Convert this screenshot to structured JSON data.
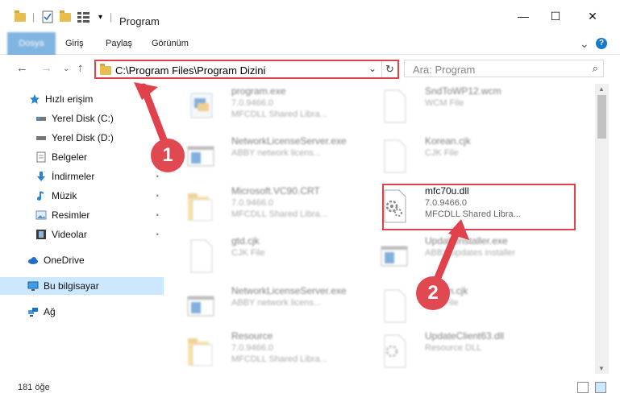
{
  "window": {
    "title": "Program",
    "minimize_glyph": "—",
    "maximize_glyph": "☐",
    "close_glyph": "✕"
  },
  "ribbon": {
    "tabs": [
      "Dosya",
      "Giriş",
      "Paylaş",
      "Görünüm"
    ],
    "expand_glyph": "⌄",
    "help_glyph": "?"
  },
  "nav": {
    "back": "←",
    "forward": "→",
    "dropdown": "⌄",
    "up": "↑"
  },
  "address": {
    "path": "C:\\Program Files\\Program Dizini",
    "dropdown": "⌄",
    "refresh": "↻"
  },
  "search": {
    "placeholder": "Ara: Program",
    "icon": "⌕"
  },
  "sidebar": {
    "items": [
      {
        "label": "Hızlı erişim",
        "icon": "star-icon"
      },
      {
        "label": "Yerel Disk (C:)",
        "icon": "drive-icon"
      },
      {
        "label": "Yerel Disk (D:)",
        "icon": "drive-icon"
      },
      {
        "label": "Belgeler",
        "icon": "document-icon"
      },
      {
        "label": "İndirmeler",
        "icon": "download-icon"
      },
      {
        "label": "Müzik",
        "icon": "music-icon"
      },
      {
        "label": "Resimler",
        "icon": "pictures-icon"
      },
      {
        "label": "Videolar",
        "icon": "video-icon"
      },
      {
        "label": "OneDrive",
        "icon": "cloud-icon"
      },
      {
        "label": "Bu bilgisayar",
        "icon": "computer-icon"
      },
      {
        "label": "Ağ",
        "icon": "network-icon"
      }
    ],
    "pin_glyph": "📌"
  },
  "files": [
    {
      "name": "program.exe",
      "line1": "7.0.9466.0",
      "line2": "MFCDLL Shared Libra...",
      "icon": "exe-icon"
    },
    {
      "name": "SndToWP12.wcm",
      "line1": "WCM File",
      "line2": "",
      "icon": "blank-file-icon"
    },
    {
      "name": "NetworkLicenseServer.exe",
      "line1": "ABBY network licens...",
      "line2": "",
      "icon": "window-app-icon"
    },
    {
      "name": "Korean.cjk",
      "line1": "CJK File",
      "line2": "",
      "icon": "blank-file-icon"
    },
    {
      "name": "Microsoft.VC90.CRT",
      "line1": "7.0.9466.0",
      "line2": "MFCDLL Shared Libra...",
      "icon": "folder-icon"
    },
    {
      "name": "mfc70u.dll",
      "line1": "7.0.9466.0",
      "line2": "MFCDLL Shared Libra...",
      "icon": "dll-gear-icon"
    },
    {
      "name": "gtd.cjk",
      "line1": "CJK File",
      "line2": "",
      "icon": "blank-file-icon"
    },
    {
      "name": "UpdateInstaller.exe",
      "line1": "ABBY updates installer",
      "line2": "",
      "icon": "window-app-icon"
    },
    {
      "name": "NetworkLicenseServer.exe",
      "line1": "ABBY network licens...",
      "line2": "",
      "icon": "window-app-icon"
    },
    {
      "name": "Korom.cjk",
      "line1": "CJK File",
      "line2": "",
      "icon": "blank-file-icon"
    },
    {
      "name": "Resource",
      "line1": "7.0.9466.0",
      "line2": "MFCDLL Shared Libra...",
      "icon": "folder-icon"
    },
    {
      "name": "UpdateClient63.dll",
      "line1": "Resource DLL",
      "line2": "",
      "icon": "dll-gear-icon"
    }
  ],
  "status": {
    "count": "181 öğe"
  },
  "annotations": {
    "badge1": "1",
    "badge2": "2"
  },
  "colors": {
    "accent": "#1979ca",
    "highlight": "#e0414b",
    "selection": "#cce8ff"
  }
}
